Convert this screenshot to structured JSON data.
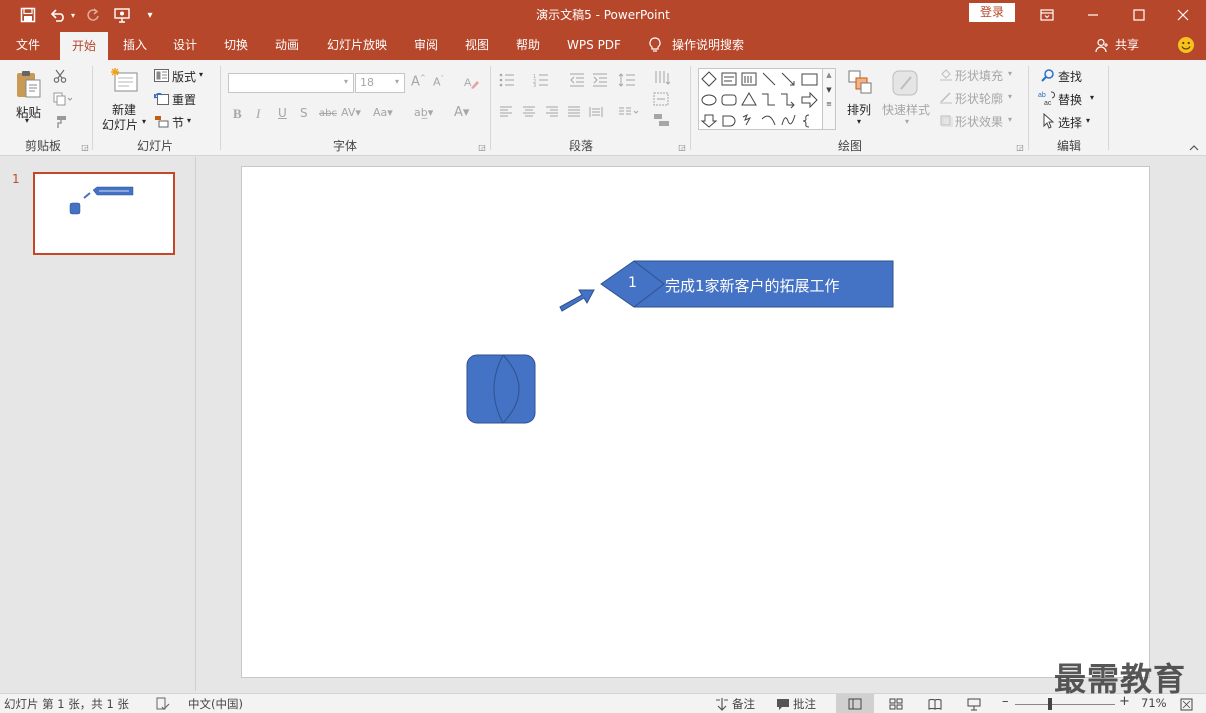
{
  "app": {
    "title": "演示文稿5 - PowerPoint",
    "login_label": "登录"
  },
  "tabs": [
    "文件",
    "开始",
    "插入",
    "设计",
    "切换",
    "动画",
    "幻灯片放映",
    "审阅",
    "视图",
    "帮助",
    "WPS PDF"
  ],
  "active_tab": "开始",
  "tell_me": "操作说明搜索",
  "share_label": "共享",
  "ribbon": {
    "clipboard": {
      "paste": "粘贴",
      "label": "剪贴板"
    },
    "slides": {
      "new_slide_line1": "新建",
      "new_slide_line2": "幻灯片",
      "layout": "版式",
      "reset": "重置",
      "section": "节",
      "label": "幻灯片"
    },
    "font": {
      "font_size": "18",
      "label": "字体"
    },
    "paragraph": {
      "label": "段落"
    },
    "drawing": {
      "arrange": "排列",
      "quick_styles": "快速样式",
      "shape_fill": "形状填充",
      "shape_outline": "形状轮廓",
      "shape_effects": "形状效果",
      "label": "绘图"
    },
    "editing": {
      "find": "查找",
      "replace": "替换",
      "select": "选择",
      "label": "编辑"
    }
  },
  "slide_panel": {
    "slide_number": "1"
  },
  "slide": {
    "callout_number": "1",
    "callout_text": "完成1家新客户的拓展工作",
    "shape_color": "#4472c4"
  },
  "status": {
    "slide_info": "幻灯片 第 1 张，共 1 张",
    "language": "中文(中国)",
    "notes": "备注",
    "comments": "批注",
    "zoom": "71%"
  },
  "watermark": "最需教育"
}
